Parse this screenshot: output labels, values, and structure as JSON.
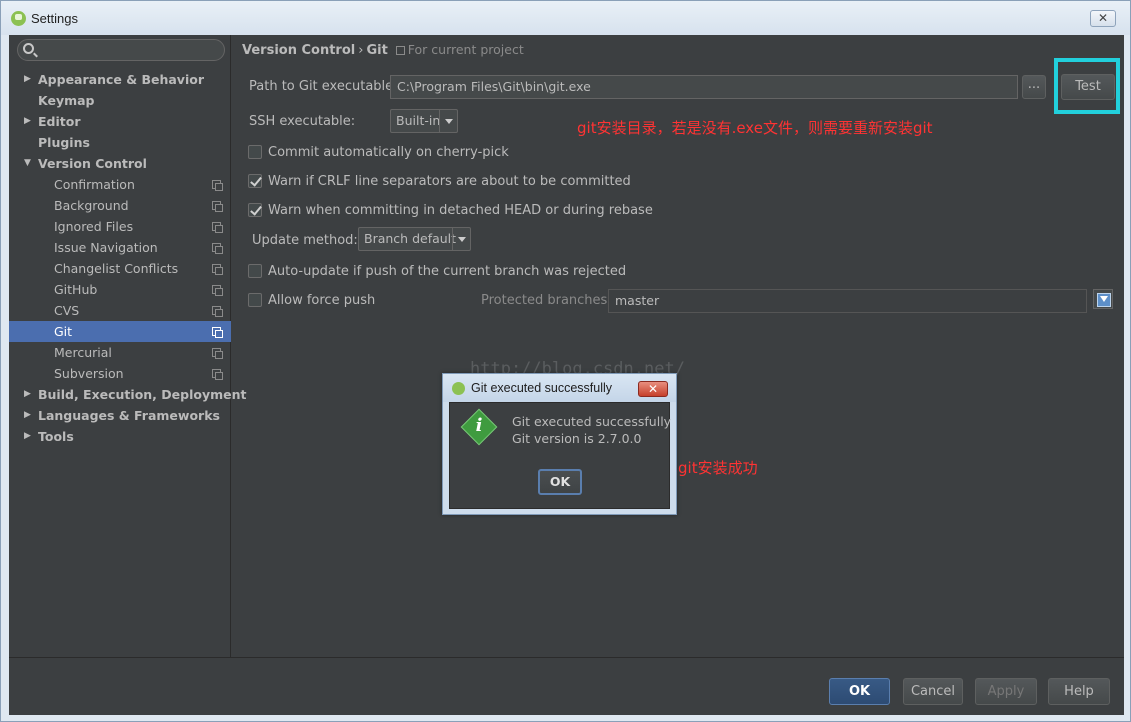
{
  "window": {
    "title": "Settings",
    "close_label": "✕"
  },
  "sidebar": {
    "search_placeholder": "",
    "items": [
      {
        "label": "Appearance & Behavior",
        "level": 0,
        "arrow": "▶"
      },
      {
        "label": "Keymap",
        "level": 0,
        "arrow": ""
      },
      {
        "label": "Editor",
        "level": 0,
        "arrow": "▶"
      },
      {
        "label": "Plugins",
        "level": 0,
        "arrow": ""
      },
      {
        "label": "Version Control",
        "level": 0,
        "arrow": "▼"
      },
      {
        "label": "Confirmation",
        "level": 1
      },
      {
        "label": "Background",
        "level": 1
      },
      {
        "label": "Ignored Files",
        "level": 1
      },
      {
        "label": "Issue Navigation",
        "level": 1
      },
      {
        "label": "Changelist Conflicts",
        "level": 1
      },
      {
        "label": "GitHub",
        "level": 1
      },
      {
        "label": "CVS",
        "level": 1
      },
      {
        "label": "Git",
        "level": 1,
        "selected": true
      },
      {
        "label": "Mercurial",
        "level": 1
      },
      {
        "label": "Subversion",
        "level": 1
      },
      {
        "label": "Build, Execution, Deployment",
        "level": 0,
        "arrow": "▶"
      },
      {
        "label": "Languages & Frameworks",
        "level": 0,
        "arrow": "▶"
      },
      {
        "label": "Tools",
        "level": 0,
        "arrow": "▶"
      }
    ]
  },
  "breadcrumb": {
    "part1": "Version Control",
    "separator": "›",
    "part2": "Git",
    "hint": "For current project"
  },
  "git": {
    "path_label": "Path to Git executable:",
    "path_value": "C:\\Program Files\\Git\\bin\\git.exe",
    "browse_label": "...",
    "test_label": "Test",
    "ssh_label": "SSH executable:",
    "ssh_value": "Built-in",
    "cherry_pick_label": "Commit automatically on cherry-pick",
    "cherry_pick_checked": false,
    "crlf_label": "Warn if CRLF line separators are about to be committed",
    "crlf_checked": true,
    "detached_label": "Warn when committing in detached HEAD or during rebase",
    "detached_checked": true,
    "update_method_label": "Update method:",
    "update_method_value": "Branch default",
    "auto_update_label": "Auto-update if push of the current branch was rejected",
    "auto_update_checked": false,
    "force_push_label": "Allow force push",
    "force_push_checked": false,
    "protected_label": "Protected branches:",
    "protected_value": "master"
  },
  "annotations": {
    "path_note": "git安装目录，若是没有.exe文件，则需要重新安装git",
    "success_note": "git安装成功",
    "watermark": "http://blog.csdn.net/"
  },
  "footer": {
    "ok": "OK",
    "cancel": "Cancel",
    "apply": "Apply",
    "help": "Help"
  },
  "popup": {
    "title": "Git executed successfully",
    "close_label": "✕",
    "line1": "Git executed successfully",
    "line2": "Git version is 2.7.0.0",
    "ok_label": "OK"
  },
  "colors": {
    "accent": "#4b6eaf",
    "highlight": "#22d0dc",
    "annotation": "#ff3333"
  }
}
